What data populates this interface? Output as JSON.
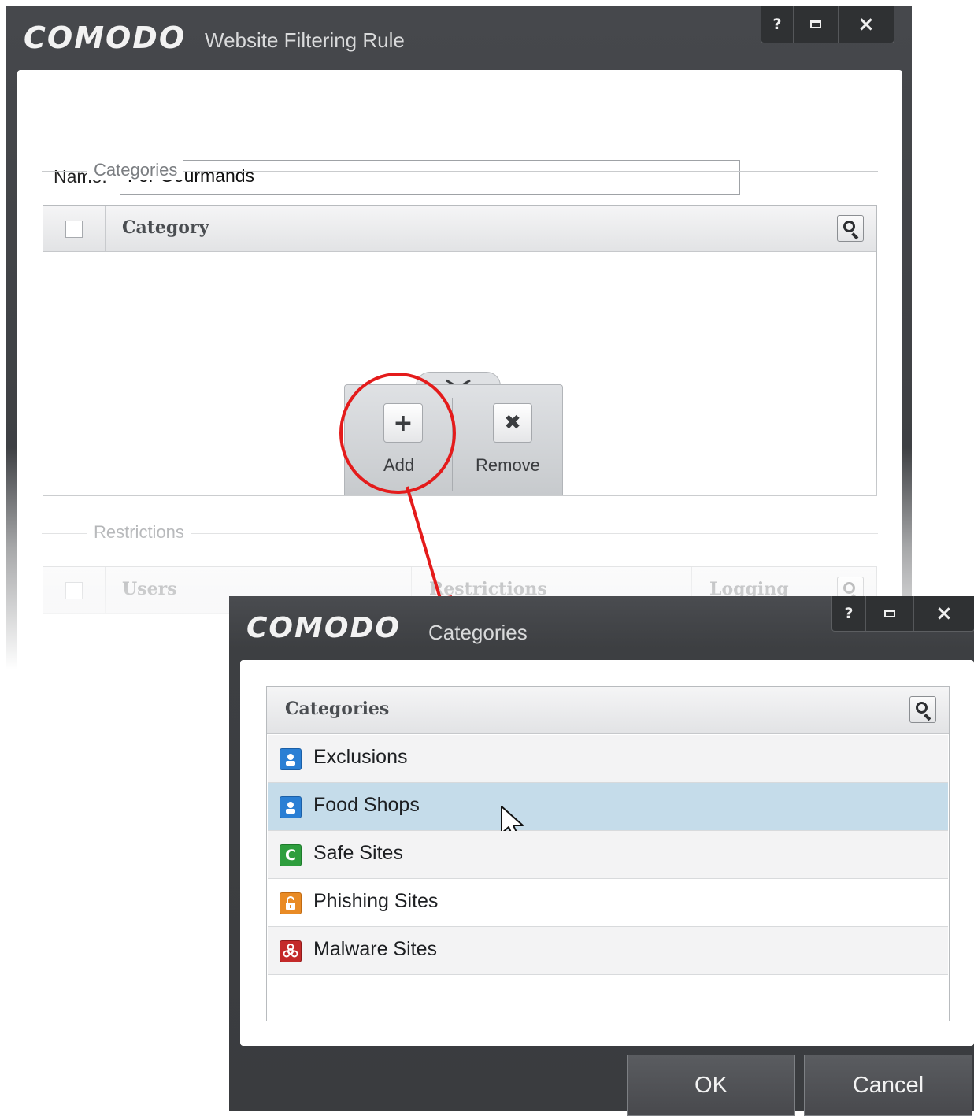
{
  "main_window": {
    "logo": "COMODO",
    "title": "Website Filtering Rule",
    "controls": {
      "help": "?",
      "close": "×"
    },
    "name_label": "Name:",
    "name_value": "For Gourmands",
    "categories_section": "Categories",
    "categories_table": {
      "header": "Category"
    },
    "popup": {
      "add_label": "Add",
      "remove_label": "Remove",
      "add_symbol": "+",
      "remove_symbol": "✖"
    },
    "restrictions_section": "Restrictions",
    "restrictions_table": {
      "columns": [
        "Users",
        "Restrictions",
        "Logging"
      ]
    }
  },
  "categories_window": {
    "logo": "COMODO",
    "title": "Categories",
    "controls": {
      "help": "?",
      "close": "×"
    },
    "table_header": "Categories",
    "items": [
      {
        "label": "Exclusions",
        "icon": "user-icon",
        "icon_color": "#2a7fd4"
      },
      {
        "label": "Food Shops",
        "icon": "user-icon",
        "icon_color": "#2a7fd4",
        "selected": true
      },
      {
        "label": "Safe Sites",
        "icon": "comodo-c-icon",
        "icon_color": "#2e9e3e"
      },
      {
        "label": "Phishing Sites",
        "icon": "lock-icon",
        "icon_color": "#e98b25"
      },
      {
        "label": "Malware Sites",
        "icon": "biohazard-icon",
        "icon_color": "#c42a2a"
      }
    ],
    "ok_label": "OK",
    "cancel_label": "Cancel"
  },
  "colors": {
    "annotation_red": "#e41b1b",
    "selected_row": "#c5dcea"
  }
}
